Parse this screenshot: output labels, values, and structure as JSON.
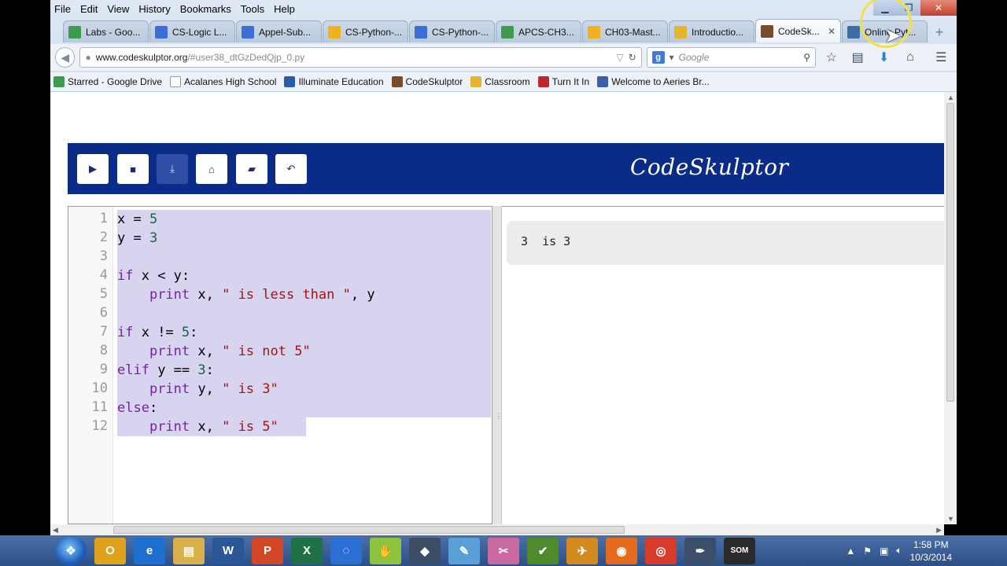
{
  "browser": {
    "menu": [
      "File",
      "Edit",
      "View",
      "History",
      "Bookmarks",
      "Tools",
      "Help"
    ],
    "tabs": [
      {
        "label": "Labs - Goo...",
        "icon": "google-drive-icon",
        "color": "#3c9b4c"
      },
      {
        "label": "CS-Logic L...",
        "icon": "google-docs-icon",
        "color": "#3b6fd6"
      },
      {
        "label": "Appel-Sub...",
        "icon": "google-docs-icon",
        "color": "#3b6fd6"
      },
      {
        "label": "CS-Python-...",
        "icon": "google-slides-icon",
        "color": "#f2b01e"
      },
      {
        "label": "CS-Python-...",
        "icon": "google-docs-icon",
        "color": "#3b6fd6"
      },
      {
        "label": "APCS-CH3...",
        "icon": "google-drive-icon",
        "color": "#3c9b4c"
      },
      {
        "label": "CH03-Mast...",
        "icon": "google-slides-icon",
        "color": "#f2b01e"
      },
      {
        "label": "Introductio...",
        "icon": "classroom-icon",
        "color": "#e2b52c"
      },
      {
        "label": "CodeSk...",
        "icon": "hammer-icon",
        "color": "#7a4a2a",
        "active": true,
        "close": "✕"
      },
      {
        "label": "Online Pyt...",
        "icon": "python-icon",
        "color": "#3a6ea5"
      }
    ],
    "new_tab": "+",
    "url_host": "www.codeskulptor.org",
    "url_path": "/#user38_dtGzDedQjp_0.py",
    "search_placeholder": "Google",
    "bookmarks": [
      {
        "label": "Starred - Google Drive",
        "icon": "google-drive-icon",
        "color": "#3c9b4c"
      },
      {
        "label": "Acalanes High School",
        "icon": "page-icon",
        "color": "#ffffff"
      },
      {
        "label": "Illuminate Education",
        "icon": "illuminate-icon",
        "color": "#2b5ca8"
      },
      {
        "label": "CodeSkulptor",
        "icon": "hammer-icon",
        "color": "#7a4a2a"
      },
      {
        "label": "Classroom",
        "icon": "classroom-icon",
        "color": "#e2b52c"
      },
      {
        "label": "Turn It In",
        "icon": "turnitin-icon",
        "color": "#c0272d"
      },
      {
        "label": "Welcome to Aeries Br...",
        "icon": "aeries-icon",
        "color": "#3b5ea8"
      }
    ]
  },
  "codeskulptor": {
    "logo": "CodeSkulptor",
    "buttons": [
      {
        "name": "run-button",
        "icon": "play-icon",
        "glyph": "▶"
      },
      {
        "name": "save-button",
        "icon": "save-icon",
        "glyph": "■"
      },
      {
        "name": "download-button",
        "icon": "download-icon",
        "glyph": "⤓",
        "active": true
      },
      {
        "name": "fresh-url-button",
        "icon": "lock-icon",
        "glyph": "⌂"
      },
      {
        "name": "open-button",
        "icon": "folder-open-icon",
        "glyph": "▰"
      },
      {
        "name": "reset-button",
        "icon": "undo-icon",
        "glyph": "↶"
      }
    ],
    "code_lines": [
      [
        {
          "t": "x",
          "c": "var"
        },
        {
          "t": " = ",
          "c": "var"
        },
        {
          "t": "5",
          "c": "num"
        }
      ],
      [
        {
          "t": "y",
          "c": "var"
        },
        {
          "t": " = ",
          "c": "var"
        },
        {
          "t": "3",
          "c": "num"
        }
      ],
      [],
      [
        {
          "t": "if",
          "c": "kw"
        },
        {
          "t": " x < y:",
          "c": "var"
        }
      ],
      [
        {
          "t": "    ",
          "c": "var"
        },
        {
          "t": "print",
          "c": "kw"
        },
        {
          "t": " x, ",
          "c": "var"
        },
        {
          "t": "\" is less than \"",
          "c": "str"
        },
        {
          "t": ", y",
          "c": "var"
        }
      ],
      [],
      [
        {
          "t": "if",
          "c": "kw"
        },
        {
          "t": " x != ",
          "c": "var"
        },
        {
          "t": "5",
          "c": "num"
        },
        {
          "t": ":",
          "c": "var"
        }
      ],
      [
        {
          "t": "    ",
          "c": "var"
        },
        {
          "t": "print",
          "c": "kw"
        },
        {
          "t": " x, ",
          "c": "var"
        },
        {
          "t": "\" is not 5\"",
          "c": "str"
        }
      ],
      [
        {
          "t": "elif",
          "c": "kw"
        },
        {
          "t": " y == ",
          "c": "var"
        },
        {
          "t": "3",
          "c": "num"
        },
        {
          "t": ":",
          "c": "var"
        }
      ],
      [
        {
          "t": "    ",
          "c": "var"
        },
        {
          "t": "print",
          "c": "kw"
        },
        {
          "t": " y, ",
          "c": "var"
        },
        {
          "t": "\" is 3\"",
          "c": "str"
        }
      ],
      [
        {
          "t": "else",
          "c": "kw"
        },
        {
          "t": ":",
          "c": "var"
        }
      ],
      [
        {
          "t": "    ",
          "c": "var"
        },
        {
          "t": "print",
          "c": "kw"
        },
        {
          "t": " x, ",
          "c": "var"
        },
        {
          "t": "\" is 5\"",
          "c": "str"
        }
      ]
    ],
    "line_numbers": [
      "1",
      "2",
      "3",
      "4",
      "5",
      "6",
      "7",
      "8",
      "9",
      "10",
      "11",
      "12"
    ],
    "output": "3  is 3"
  },
  "taskbar": {
    "apps": [
      {
        "name": "outlook",
        "glyph": "O",
        "color": "#e0a21b"
      },
      {
        "name": "internet-explorer",
        "glyph": "e",
        "color": "#1f6fd1"
      },
      {
        "name": "file-explorer",
        "glyph": "▤",
        "color": "#d9b04a"
      },
      {
        "name": "word",
        "glyph": "W",
        "color": "#2b5797"
      },
      {
        "name": "powerpoint",
        "glyph": "P",
        "color": "#d24726"
      },
      {
        "name": "excel",
        "glyph": "X",
        "color": "#1e7145"
      },
      {
        "name": "app-dots",
        "glyph": "◌",
        "color": "#2a6fd1"
      },
      {
        "name": "app-hand",
        "glyph": "✋",
        "color": "#8fc33d"
      },
      {
        "name": "app-penguin",
        "glyph": "◆",
        "color": "#3c4d66"
      },
      {
        "name": "paint",
        "glyph": "✎",
        "color": "#5aa0d8"
      },
      {
        "name": "snipping-tool",
        "glyph": "✂",
        "color": "#c86aa0"
      },
      {
        "name": "app-green",
        "glyph": "✔",
        "color": "#4f8a2b"
      },
      {
        "name": "app-bird",
        "glyph": "✈",
        "color": "#d48a1e"
      },
      {
        "name": "firefox",
        "glyph": "◉",
        "color": "#e56b1f"
      },
      {
        "name": "chrome",
        "glyph": "◎",
        "color": "#d93b2b"
      },
      {
        "name": "app-pen",
        "glyph": "✒",
        "color": "#3b4f6a"
      },
      {
        "name": "app-som",
        "glyph": "SOM",
        "color": "#2a2a2a"
      }
    ],
    "time": "1:58 PM",
    "date": "10/3/2014"
  }
}
